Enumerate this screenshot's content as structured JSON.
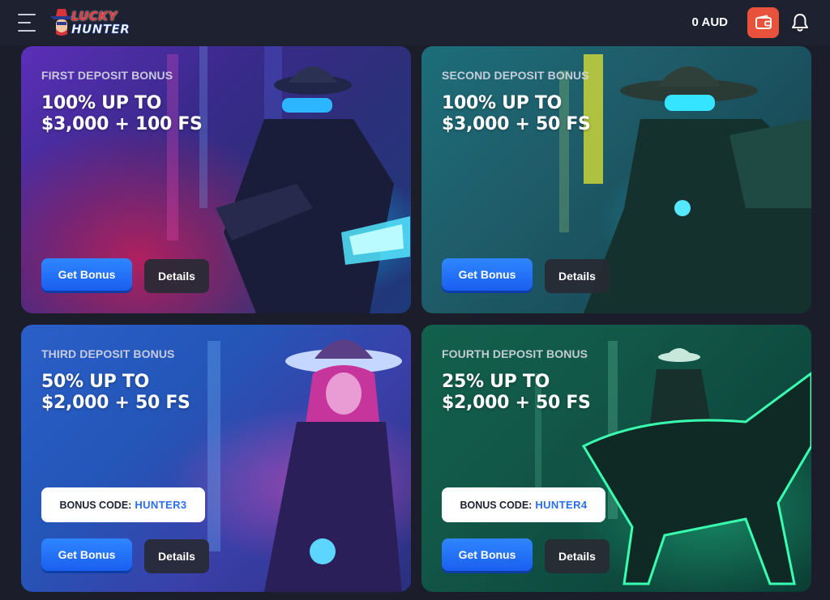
{
  "header": {
    "logo_line1": "LUCKY",
    "logo_line2": "HUNTER",
    "balance": "0 AUD",
    "colors": {
      "wallet": "#e8513a",
      "bar": "#1e2230"
    }
  },
  "cards": [
    {
      "eyebrow": "FIRST DEPOSIT BONUS",
      "headline_line1": "100% UP TO",
      "headline_line2": "$3,000 + 100 FS",
      "get_label": "Get Bonus",
      "details_label": "Details"
    },
    {
      "eyebrow": "SECOND DEPOSIT BONUS",
      "headline_line1": "100% UP TO",
      "headline_line2": "$3,000 + 50 FS",
      "get_label": "Get Bonus",
      "details_label": "Details"
    },
    {
      "eyebrow": "THIRD DEPOSIT BONUS",
      "headline_line1": "50% UP TO",
      "headline_line2": "$2,000 + 50 FS",
      "code_label": "BONUS CODE:",
      "code_value": "HUNTER3",
      "get_label": "Get Bonus",
      "details_label": "Details"
    },
    {
      "eyebrow": "FOURTH DEPOSIT BONUS",
      "headline_line1": "25% UP TO",
      "headline_line2": "$2,000 + 50 FS",
      "code_label": "BONUS CODE:",
      "code_value": "HUNTER4",
      "get_label": "Get Bonus",
      "details_label": "Details"
    }
  ],
  "icons": [
    "menu-icon",
    "logo-hat-icon",
    "wallet-icon",
    "bell-icon"
  ]
}
